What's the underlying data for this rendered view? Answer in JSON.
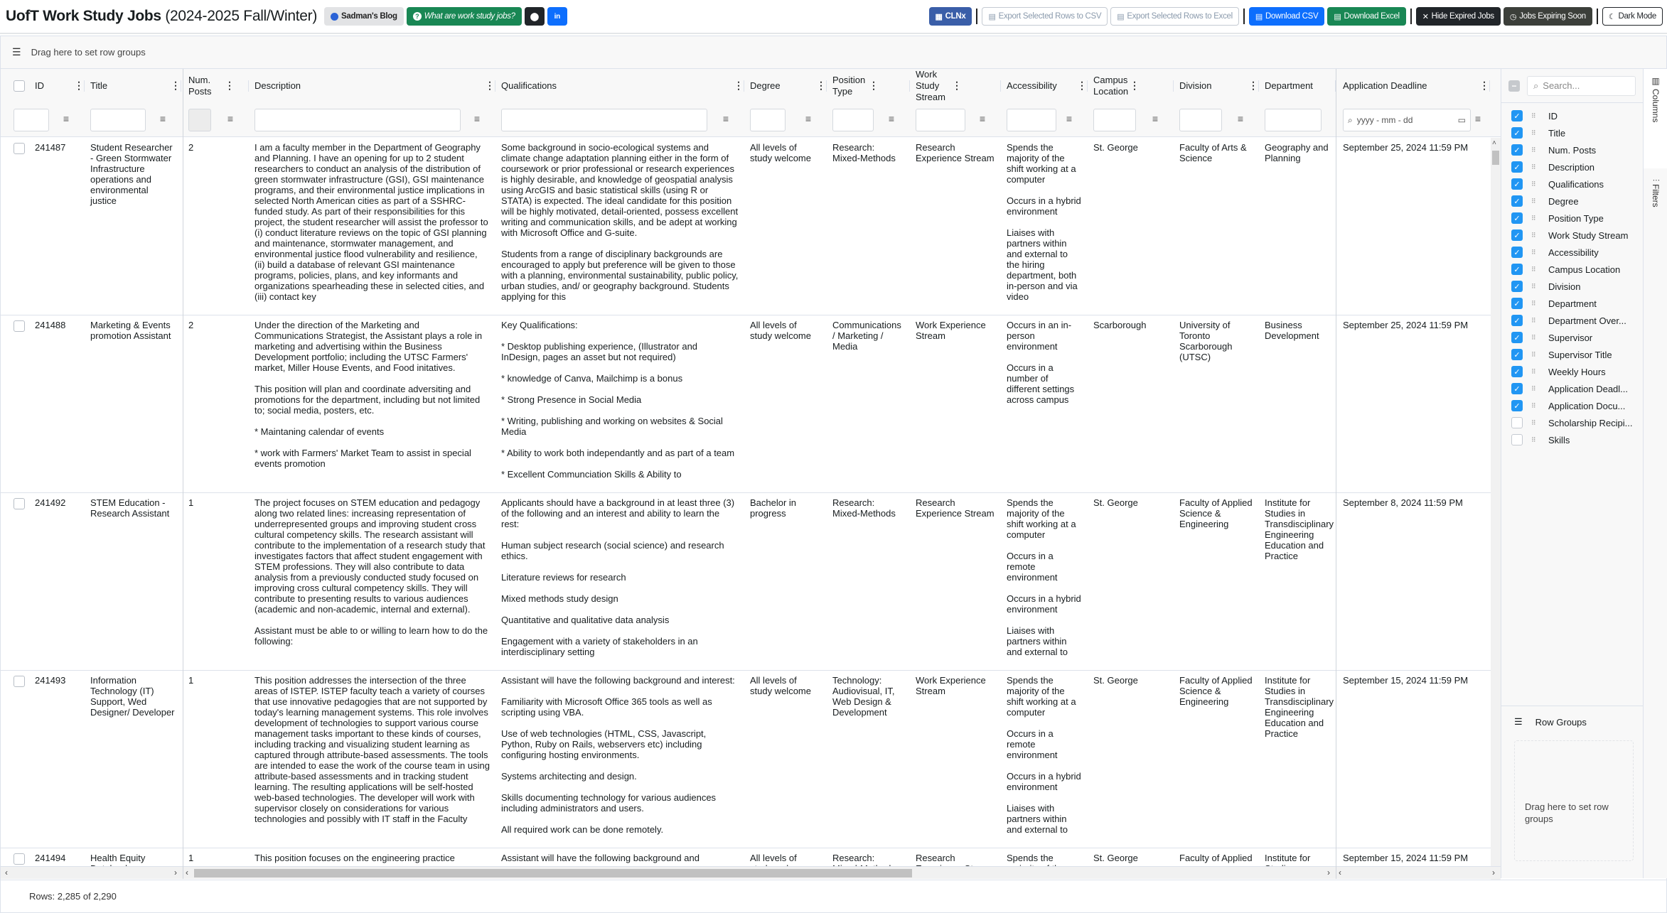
{
  "header": {
    "title_main": "UofT Work Study Jobs",
    "title_sub": " (2024-2025 Fall/Winter)",
    "buttons": {
      "blog": "Sadman's Blog",
      "what": "What are work study jobs?",
      "github_icon": "github-icon",
      "linkedin_icon": "linkedin-icon",
      "clnx": "CLNx",
      "export_csv": "Export Selected Rows to CSV",
      "export_excel": "Export Selected Rows to Excel",
      "download_csv": "Download CSV",
      "download_excel": "Download Excel",
      "hide_expired": "Hide Expired Jobs",
      "expiring_soon": "Jobs Expiring Soon",
      "dark_mode": "Dark Mode"
    }
  },
  "grid": {
    "row_group_hint": "Drag here to set row groups",
    "columns": [
      {
        "key": "id",
        "label": "ID"
      },
      {
        "key": "title",
        "label": "Title"
      },
      {
        "key": "posts",
        "label": "Num. Posts"
      },
      {
        "key": "description",
        "label": "Description"
      },
      {
        "key": "qualifications",
        "label": "Qualifications"
      },
      {
        "key": "degree",
        "label": "Degree"
      },
      {
        "key": "position_type",
        "label": "Position Type"
      },
      {
        "key": "stream",
        "label": "Work Study Stream"
      },
      {
        "key": "accessibility",
        "label": "Accessibility"
      },
      {
        "key": "campus",
        "label": "Campus Location"
      },
      {
        "key": "division",
        "label": "Division"
      },
      {
        "key": "department",
        "label": "Department"
      },
      {
        "key": "deadline",
        "label": "Application Deadline"
      }
    ],
    "deadline_filter_placeholder": "yyyy - mm - dd",
    "rows": [
      {
        "id": "241487",
        "title": "Student Researcher - Green Stormwater Infrastructure operations and environmental justice",
        "posts": "2",
        "description": "I am a faculty member in the Department of Geography and Planning. I have an opening for up to 2 student researchers to conduct an analysis of the distribution of green stormwater infrastructure (GSI), GSI maintenance programs, and their environmental justice implications in selected North American cities as part of a SSHRC-funded study. As part of their responsibilities for this project, the student researcher will assist the professor to (i) conduct literature reviews on the topic of GSI planning and maintenance, stormwater management, and environmental justice flood vulnerability and resilience, (ii) build a database of relevant GSI maintenance programs, policies, plans, and key informants and organizations spearheading these in selected cities, and (iii) contact key",
        "qualifications": "Some background in socio-ecological systems and climate change adaptation planning either in the form of coursework or prior professional or research experiences is highly desirable, and knowledge of geospatial analysis using ArcGIS and basic statistical skills (using R or STATA) is expected. The ideal candidate for this position will be highly motivated, detail-oriented, possess excellent writing and communication skills, and be adept at working with Microsoft Office and G-suite.\n\nStudents from a range of disciplinary backgrounds are encouraged to apply but preference will be given to those with a planning, environmental sustainability, public policy, urban studies, and/ or geography background. Students applying for this",
        "degree": "All levels of study welcome",
        "position_type": "Research: Mixed-Methods",
        "stream": "Research Experience Stream",
        "accessibility": "Spends the majority of the shift working at a computer\n\nOccurs in a hybrid environment\n\nLiaises with partners within and external to the hiring department, both in-person and via video",
        "campus": "St. George",
        "division": "Faculty of Arts & Science",
        "department": "Geography and Planning",
        "deadline": "September 25, 2024 11:59 PM"
      },
      {
        "id": "241488",
        "title": "Marketing & Events promotion Assistant",
        "posts": "2",
        "description": "Under the direction of the Marketing and Communications Strategist, the Assistant plays a role in marketing and advertising within the Business Development portfolio; including the UTSC Farmers' market, Miller House Events, and Food initatives.\n\nThis position will plan and coordinate adversiting and promotions for the department, including but not limited to; social media, posters, etc.\n\n* Maintaning calendar of events\n\n* work with Farmers' Market Team to assist in special events promotion",
        "qualifications": "Key Qualifications:\n\n* Desktop publishing experience, (Illustrator and InDesign, pages an asset but not required)\n\n* knowledge of Canva, Mailchimp is a bonus\n\n* Strong Presence in Social Media\n\n* Writing, publishing and working on websites & Social Media\n\n* Ability to work both independantly and as part of a team\n\n* Excellent Communciation Skills & Ability to",
        "degree": "All levels of study welcome",
        "position_type": "Communications / Marketing / Media",
        "stream": "Work Experience Stream",
        "accessibility": "Occurs in an in-person environment\n\nOccurs in a number of different settings across campus",
        "campus": "Scarborough",
        "division": "University of Toronto Scarborough (UTSC)",
        "department": "Business Development",
        "deadline": "September 25, 2024 11:59 PM"
      },
      {
        "id": "241492",
        "title": "STEM Education - Research Assistant",
        "posts": "1",
        "description": "The project focuses on STEM education and pedagogy along two related lines: increasing representation of underrepresented groups and improving student cross cultural competency skills. The research assistant will contribute to the implementation of a research study that investigates factors that affect student engagement with STEM professions. They will also contribute to data analysis from a previously conducted study focused on improving cross cultural competency skills. They will contribute to presenting results to various audiences (academic and non-academic, internal and external).\n\nAssistant must be able to or willing to learn how to do the following:",
        "qualifications": "Applicants should have a background in at least three (3) of the following and an interest and ability to learn the rest:\n\nHuman subject research (social science) and research ethics.\n\nLiterature reviews for research\n\nMixed methods study design\n\nQuantitative and qualitative data analysis\n\nEngagement with a variety of stakeholders in an interdisciplinary setting",
        "degree": "Bachelor in progress",
        "position_type": "Research: Mixed-Methods",
        "stream": "Research Experience Stream",
        "accessibility": "Spends the majority of the shift working at a computer\n\nOccurs in a remote environment\n\nOccurs in a hybrid environment\n\nLiaises with partners within and external to",
        "campus": "St. George",
        "division": "Faculty of Applied Science & Engineering",
        "department": "Institute for Studies in Transdisciplinary Engineering Education and Practice",
        "deadline": "September 8, 2024 11:59 PM"
      },
      {
        "id": "241493",
        "title": "Information Technology (IT) Support, Wed Designer/ Developer",
        "posts": "1",
        "description": "This position addresses the intersection of the three areas of ISTEP. ISTEP faculty teach a variety of courses that use innovative pedagogies that are not supported by today's learning management systems. This role involves development of technologies to support various course management tasks important to these kinds of courses, including tracking and visualizing student learning as captured through attribute-based assessments. The tools are intended to ease the work of the course team in using attribute-based assessments and in tracking student learning. The resulting applications will be self-hosted web-based technologies. The developer will work with supervisor closely on considerations for various technologies and possibly with IT staff in the Faculty",
        "qualifications": "Assistant will have the following background and interest:\n\nFamiliarity with Microsoft Office 365 tools as well as scripting using VBA.\n\nUse of web technologies (HTML, CSS, Javascript, Python, Ruby on Rails, webservers etc) including configuring hosting environments.\n\nSystems architecting and design.\n\nSkills documenting technology for various audiences including administrators and users.\n\nAll required work can be done remotely.",
        "degree": "All levels of study welcome",
        "position_type": "Technology: Audiovisual, IT, Web Design & Development",
        "stream": "Work Experience Stream",
        "accessibility": "Spends the majority of the shift working at a computer\n\nOccurs in a remote environment\n\nOccurs in a hybrid environment\n\nLiaises with partners within and external to",
        "campus": "St. George",
        "division": "Faculty of Applied Science & Engineering",
        "department": "Institute for Studies in Transdisciplinary Engineering Education and Practice",
        "deadline": "September 15, 2024 11:59 PM"
      },
      {
        "id": "241494",
        "title": "Health Equity Databank",
        "posts": "1",
        "description": "This position focuses on the engineering practice",
        "qualifications": "Assistant will have the following background and",
        "degree": "All levels of study welcome",
        "position_type": "Research: Mixed-Methods",
        "stream": "Research Experience Stream",
        "accessibility": "Spends the majority of the",
        "campus": "St. George",
        "division": "Faculty of Applied",
        "department": "Institute for Studies",
        "deadline": "September 15, 2024 11:59 PM"
      }
    ],
    "status": "Rows: 2,285 of 2,290"
  },
  "side_panel": {
    "search_placeholder": "Search...",
    "columns": [
      {
        "label": "ID",
        "checked": true
      },
      {
        "label": "Title",
        "checked": true
      },
      {
        "label": "Num. Posts",
        "checked": true
      },
      {
        "label": "Description",
        "checked": true
      },
      {
        "label": "Qualifications",
        "checked": true
      },
      {
        "label": "Degree",
        "checked": true
      },
      {
        "label": "Position Type",
        "checked": true
      },
      {
        "label": "Work Study Stream",
        "checked": true
      },
      {
        "label": "Accessibility",
        "checked": true
      },
      {
        "label": "Campus Location",
        "checked": true
      },
      {
        "label": "Division",
        "checked": true
      },
      {
        "label": "Department",
        "checked": true
      },
      {
        "label": "Department Over...",
        "checked": true
      },
      {
        "label": "Supervisor",
        "checked": true
      },
      {
        "label": "Supervisor Title",
        "checked": true
      },
      {
        "label": "Weekly Hours",
        "checked": true
      },
      {
        "label": "Application Deadl...",
        "checked": true
      },
      {
        "label": "Application Docu...",
        "checked": true
      },
      {
        "label": "Scholarship Recipi...",
        "checked": false
      },
      {
        "label": "Skills",
        "checked": false
      }
    ],
    "row_groups_title": "Row Groups",
    "row_groups_hint": "Drag here to set row groups",
    "tabs": {
      "columns": "Columns",
      "filters": "Filters"
    }
  }
}
